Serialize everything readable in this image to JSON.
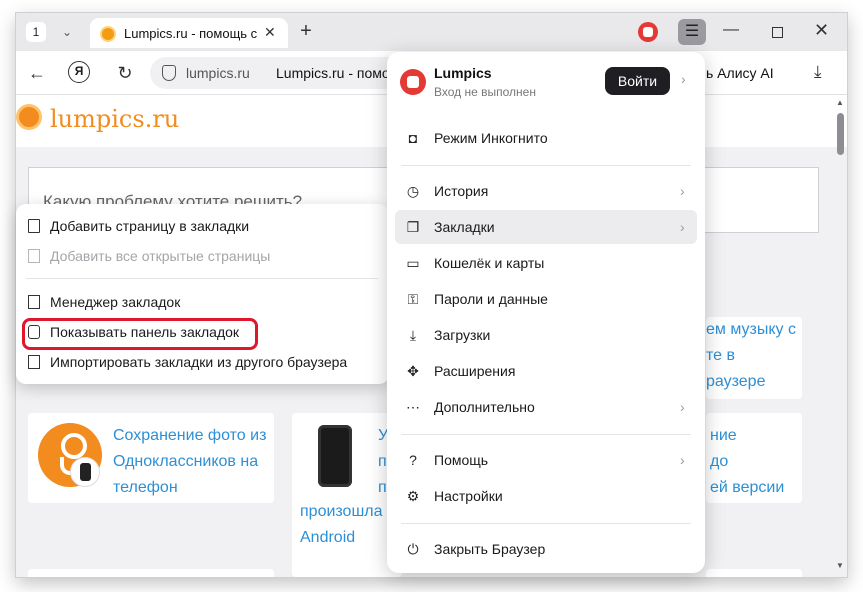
{
  "tabs": {
    "count": "1",
    "active_title": "Lumpics.ru - помощь с компьютером"
  },
  "nav": {
    "url_domain": "lumpics.ru",
    "url_title": "Lumpics.ru - помощь с компьютером",
    "alice_label": "ь Алису AI"
  },
  "site": {
    "logo_text": "lumpics.ru",
    "search_placeholder": "Какую проблему хотите решить?",
    "cards": [
      {
        "title_lines": [
          "Сохранение фото из",
          "Одноклассников на",
          "телефон"
        ]
      },
      {
        "title_lines": [
          "У",
          "п",
          "п",
          "произошла",
          "Android"
        ]
      },
      {
        "title_lines": [
          "ние",
          "до",
          "ей версии"
        ]
      },
      {
        "title_lines": [
          "ем музыку с",
          "те в",
          "раузере"
        ]
      }
    ]
  },
  "bookmarks_submenu": {
    "items": [
      {
        "label": "Добавить страницу в закладки",
        "icon": "bookmark-icon",
        "disabled": false
      },
      {
        "label": "Добавить все открытые страницы",
        "icon": "bookmarks-multiple-icon",
        "disabled": true
      },
      {
        "label": "Менеджер закладок",
        "icon": "bookmark-manager-icon",
        "disabled": false
      },
      {
        "label": "Показывать панель закладок",
        "icon": "bookmarks-bar-icon",
        "disabled": false,
        "highlighted": true
      },
      {
        "label": "Импортировать закладки из другого браузера",
        "icon": "import-icon",
        "disabled": false
      }
    ]
  },
  "main_menu": {
    "profile": {
      "name": "Lumpics",
      "status": "Вход не выполнен",
      "login_button": "Войти"
    },
    "items": [
      {
        "label": "Режим Инкогнито",
        "icon": "incognito-icon",
        "has_submenu": false
      },
      {
        "label": "История",
        "icon": "history-icon",
        "has_submenu": true
      },
      {
        "label": "Закладки",
        "icon": "bookmarks-icon",
        "has_submenu": true,
        "active": true
      },
      {
        "label": "Кошелёк и карты",
        "icon": "wallet-icon",
        "has_submenu": false
      },
      {
        "label": "Пароли и данные",
        "icon": "passwords-icon",
        "has_submenu": false
      },
      {
        "label": "Загрузки",
        "icon": "downloads-icon",
        "has_submenu": false
      },
      {
        "label": "Расширения",
        "icon": "extensions-icon",
        "has_submenu": false
      },
      {
        "label": "Дополнительно",
        "icon": "more-icon",
        "has_submenu": true
      },
      {
        "label": "Помощь",
        "icon": "help-icon",
        "has_submenu": true
      },
      {
        "label": "Настройки",
        "icon": "settings-icon",
        "has_submenu": false
      },
      {
        "label": "Закрыть Браузер",
        "icon": "power-icon",
        "has_submenu": false
      }
    ]
  },
  "colors": {
    "accent_orange": "#f28c1e",
    "link_blue": "#2d8fd5",
    "highlight_red": "#e0162b"
  }
}
